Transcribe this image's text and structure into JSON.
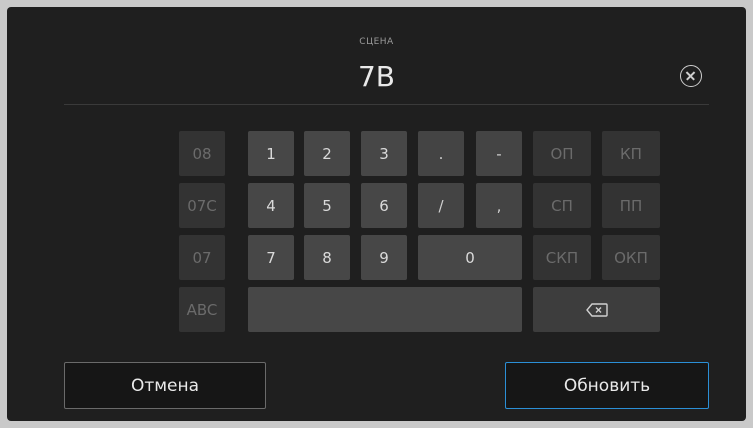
{
  "field": {
    "label": "СЦЕНА",
    "value": "7B"
  },
  "keypad": {
    "history": [
      "08",
      "07C",
      "07"
    ],
    "abc": "ABC",
    "digits": [
      "1",
      "2",
      "3",
      "4",
      "5",
      "6",
      "7",
      "8",
      "9",
      "0"
    ],
    "symbols": [
      ".",
      "-",
      "/",
      ","
    ],
    "shot_types": [
      "ОП",
      "КП",
      "СП",
      "ПП",
      "СКП",
      "ОКП"
    ]
  },
  "buttons": {
    "cancel": "Отмена",
    "update": "Обновить"
  },
  "colors": {
    "accent_border": "#2b8fd6"
  }
}
